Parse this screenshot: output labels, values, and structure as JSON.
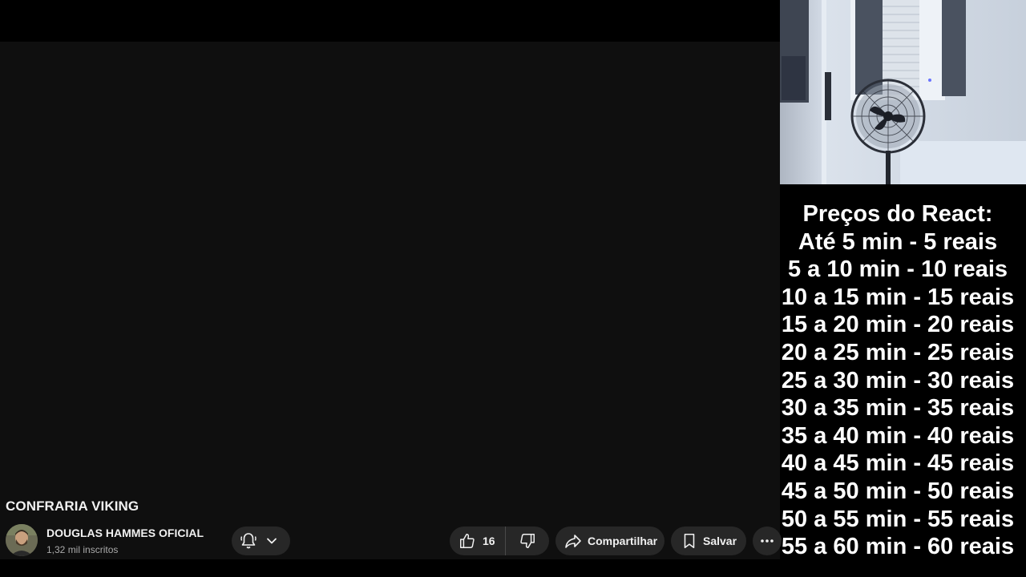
{
  "video": {
    "title": "CONFRARIA VIKING"
  },
  "channel": {
    "name": "DOUGLAS HAMMES OFICIAL",
    "subscribers": "1,32 mil inscritos"
  },
  "actions": {
    "like_count": "16",
    "share_label": "Compartilhar",
    "save_label": "Salvar",
    "more_label": "···"
  },
  "overlay": {
    "price_lines": [
      "Preços do React:",
      "Até 5 min - 5 reais",
      "5 a 10 min - 10 reais",
      "10 a 15 min - 15 reais",
      "15 a 20 min - 20 reais",
      "20 a 25 min - 25 reais",
      "25 a 30 min - 30 reais",
      "30 a 35 min - 35 reais",
      "35 a 40 min - 40 reais",
      "40 a 45 min - 45 reais",
      "45 a 50 min - 50 reais",
      "50 a 55 min - 55 reais",
      "55 a 60 min - 60 reais"
    ]
  },
  "icons": {
    "bell": "notification-bell-icon",
    "chevron": "chevron-down-icon",
    "like": "thumbs-up-icon",
    "dislike": "thumbs-down-icon",
    "share": "share-arrow-icon",
    "save": "bookmark-icon",
    "more": "more-horizontal-icon"
  },
  "colors": {
    "page_background": "#0f0f0f",
    "pill_background": "#272727",
    "primary_text": "#f1f1f1",
    "secondary_text": "#aaaaaa",
    "overlay_text": "#ffffff"
  }
}
